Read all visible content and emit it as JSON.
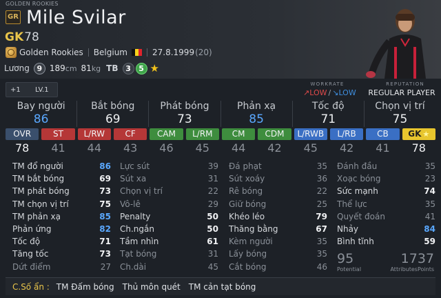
{
  "header": {
    "season_title": "GOLDEN ROOKIES",
    "season_code": "GR",
    "player_name": "Mile Svilar",
    "position": "GK",
    "ovr": "78",
    "team": "Golden Rookies",
    "nation": "Belgium",
    "dob": "27.8.1999",
    "age": "(20)",
    "salary_label": "Lương",
    "salary": "9",
    "height": "189",
    "height_unit": "cm",
    "weight": "81",
    "weight_unit": "kg",
    "tb_label": "TB",
    "weak_foot": "3",
    "skill_moves": "5"
  },
  "bar": {
    "plus": "+1",
    "level": "LV.1",
    "workrate_title": "WORKRATE",
    "workrate_att": "LOW",
    "workrate_def": "LOW",
    "reputation_title": "REPUTATION",
    "reputation": "REGULAR PLAYER"
  },
  "main_stats": [
    {
      "label": "Bay người",
      "value": "86"
    },
    {
      "label": "Bắt bóng",
      "value": "69"
    },
    {
      "label": "Phát bóng",
      "value": "73"
    },
    {
      "label": "Phản xạ",
      "value": "85"
    },
    {
      "label": "Tốc độ",
      "value": "71"
    },
    {
      "label": "Chọn vị trí",
      "value": "75"
    }
  ],
  "positions": [
    {
      "tag": "OVR",
      "value": "78",
      "color": "#3a4f6c"
    },
    {
      "tag": "ST",
      "value": "41",
      "color": "#b53737"
    },
    {
      "tag": "L/RW",
      "value": "44",
      "color": "#b53737"
    },
    {
      "tag": "CF",
      "value": "43",
      "color": "#b53737"
    },
    {
      "tag": "CAM",
      "value": "46",
      "color": "#3e8d3e"
    },
    {
      "tag": "L/RM",
      "value": "45",
      "color": "#3e8d3e"
    },
    {
      "tag": "CM",
      "value": "44",
      "color": "#3e8d3e"
    },
    {
      "tag": "CDM",
      "value": "42",
      "color": "#3e8d3e"
    },
    {
      "tag": "L/RWB",
      "value": "45",
      "color": "#3a6fc4"
    },
    {
      "tag": "L/RB",
      "value": "42",
      "color": "#3a6fc4"
    },
    {
      "tag": "CB",
      "value": "41",
      "color": "#3a6fc4"
    },
    {
      "tag": "GK",
      "value": "78",
      "color": "#e8c62e"
    }
  ],
  "attributes": {
    "col1": [
      {
        "name": "TM đổ người",
        "value": "86"
      },
      {
        "name": "TM bắt bóng",
        "value": "69"
      },
      {
        "name": "TM phát bóng",
        "value": "73"
      },
      {
        "name": "TM chọn vị trí",
        "value": "75"
      },
      {
        "name": "TM phản xạ",
        "value": "85"
      },
      {
        "name": "Phản ứng",
        "value": "82"
      },
      {
        "name": "Tốc độ",
        "value": "71"
      },
      {
        "name": "Tăng tốc",
        "value": "73"
      },
      {
        "name": "Dứt điểm",
        "value": "27"
      }
    ],
    "col2": [
      {
        "name": "Lực sút",
        "value": "39"
      },
      {
        "name": "Sút xa",
        "value": "31"
      },
      {
        "name": "Chọn vị trí",
        "value": "22"
      },
      {
        "name": "Vô-lê",
        "value": "29"
      },
      {
        "name": "Penalty",
        "value": "50"
      },
      {
        "name": "Ch.ngắn",
        "value": "50"
      },
      {
        "name": "Tầm nhìn",
        "value": "61"
      },
      {
        "name": "Tạt bóng",
        "value": "31"
      },
      {
        "name": "Ch.dài",
        "value": "45"
      }
    ],
    "col3": [
      {
        "name": "Đá phạt",
        "value": "35"
      },
      {
        "name": "Sút xoáy",
        "value": "36"
      },
      {
        "name": "Rê bóng",
        "value": "22"
      },
      {
        "name": "Giữ bóng",
        "value": "25"
      },
      {
        "name": "Khéo léo",
        "value": "79"
      },
      {
        "name": "Thăng bằng",
        "value": "67"
      },
      {
        "name": "Kèm người",
        "value": "35"
      },
      {
        "name": "Lấy bóng",
        "value": "35"
      },
      {
        "name": "Cắt bóng",
        "value": "46"
      }
    ],
    "col4": [
      {
        "name": "Đánh đầu",
        "value": "35"
      },
      {
        "name": "Xoạc bóng",
        "value": "23"
      },
      {
        "name": "Sức mạnh",
        "value": "74"
      },
      {
        "name": "Thể lực",
        "value": "35"
      },
      {
        "name": "Quyết đoán",
        "value": "41"
      },
      {
        "name": "Nhảy",
        "value": "84"
      },
      {
        "name": "Bình tĩnh",
        "value": "59"
      }
    ],
    "potential": "95",
    "potential_label": "Potential",
    "attribute_points": "1737",
    "attribute_points_label": "AttributesPoints"
  },
  "traits": {
    "label": "C.Số ẩn :",
    "items": [
      "TM Đấm bóng",
      "Thủ môn quét",
      "TM cản tạt bóng"
    ]
  }
}
